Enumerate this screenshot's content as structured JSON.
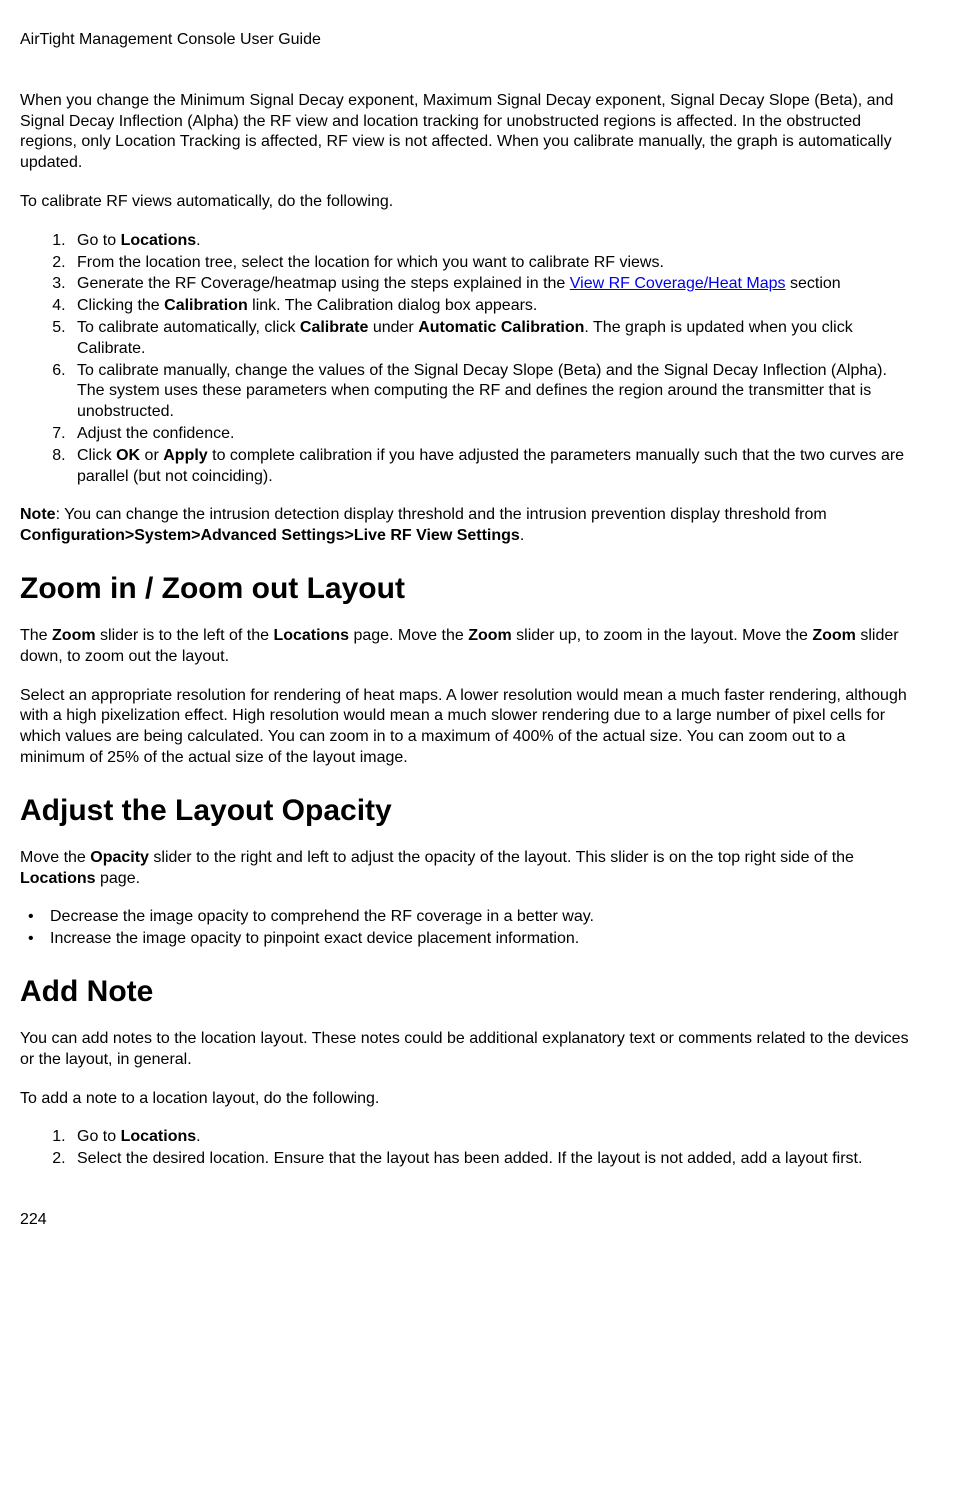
{
  "header_title": "AirTight Management Console User Guide",
  "intro_para": {
    "prefix": "When you change the Minimum Signal Decay exponent, Maximum Signal Decay exponent, Signal Decay Slope (Beta), and Signal Decay Inflection (Alpha) the RF view and location tracking for unobstructed regions is affected. In the obstructed regions, only Location Tracking is affected, RF view is not affected. When you calibrate manually, the graph is automatically updated."
  },
  "calibrate_intro": "To calibrate RF views automatically, do the following.",
  "ol1": {
    "item1_pre": "Go to ",
    "item1_bold": "Locations",
    "item1_post": ".",
    "item2": "From the location tree, select the location for which you want to calibrate RF views.",
    "item3_pre": "Generate the RF Coverage/heatmap using the steps explained in the ",
    "item3_link": "View RF Coverage/Heat Maps",
    "item3_post": " section",
    "item4_pre": "Clicking the ",
    "item4_bold": "Calibration",
    "item4_post": " link. The Calibration dialog box appears.",
    "item5_pre": "To calibrate automatically, click ",
    "item5_bold1": "Calibrate",
    "item5_mid": " under ",
    "item5_bold2": "Automatic Calibration",
    "item5_post": ". The graph is updated when you click Calibrate.",
    "item6": "To calibrate manually, change the values of the Signal Decay Slope (Beta) and the Signal Decay Inflection (Alpha). The system uses these parameters when computing the RF and defines the region around the transmitter that is unobstructed.",
    "item7": "Adjust the confidence.",
    "item8_pre": "Click ",
    "item8_bold1": "OK",
    "item8_mid": " or ",
    "item8_bold2": "Apply",
    "item8_post": " to complete calibration if you have adjusted the parameters manually such that the two curves are parallel (but not coinciding)."
  },
  "note": {
    "label": "Note",
    "text_pre": ": You can change the intrusion detection display threshold and the intrusion prevention display threshold from ",
    "bold_path": "Configuration>System>Advanced Settings>Live RF View Settings",
    "text_post": "."
  },
  "h2_zoom": "Zoom in / Zoom out Layout",
  "zoom_para1": {
    "p1": "The ",
    "b1": "Zoom",
    "p2": " slider is to the left of the ",
    "b2": "Locations",
    "p3": " page. Move the ",
    "b3": "Zoom",
    "p4": " slider up, to zoom in the layout. Move the ",
    "b4": "Zoom",
    "p5": " slider down, to zoom out the layout."
  },
  "zoom_para2": "Select an appropriate resolution for rendering of heat maps. A lower resolution would mean a much faster rendering, although with a high pixelization effect. High resolution would mean a much slower rendering due to a large number of pixel cells for which values are being calculated. You can zoom in to a maximum of 400% of the actual size. You can zoom out to a minimum of 25% of the actual size of the layout image.",
  "h2_opacity": "Adjust the Layout Opacity",
  "opacity_para": {
    "p1": "Move the ",
    "b1": "Opacity",
    "p2": " slider to the right and left to adjust the opacity of the layout. This slider is on the top right side of the ",
    "b2": "Locations",
    "p3": " page."
  },
  "opacity_bullets": {
    "b1": "Decrease the image opacity to comprehend the RF coverage in a better way.",
    "b2": "Increase the image opacity to pinpoint exact device placement information."
  },
  "h2_addnote": "Add Note",
  "addnote_para1": "You can add notes to the location layout. These notes could be additional explanatory text or comments related to the devices or the layout, in general.",
  "addnote_para2": "To add a note to a location layout, do the following.",
  "ol2": {
    "item1_pre": "Go to ",
    "item1_bold": "Locations",
    "item1_post": ".",
    "item2": "Select the desired location. Ensure that the layout has been added. If the layout is not added, add a layout first."
  },
  "page_number": "224"
}
